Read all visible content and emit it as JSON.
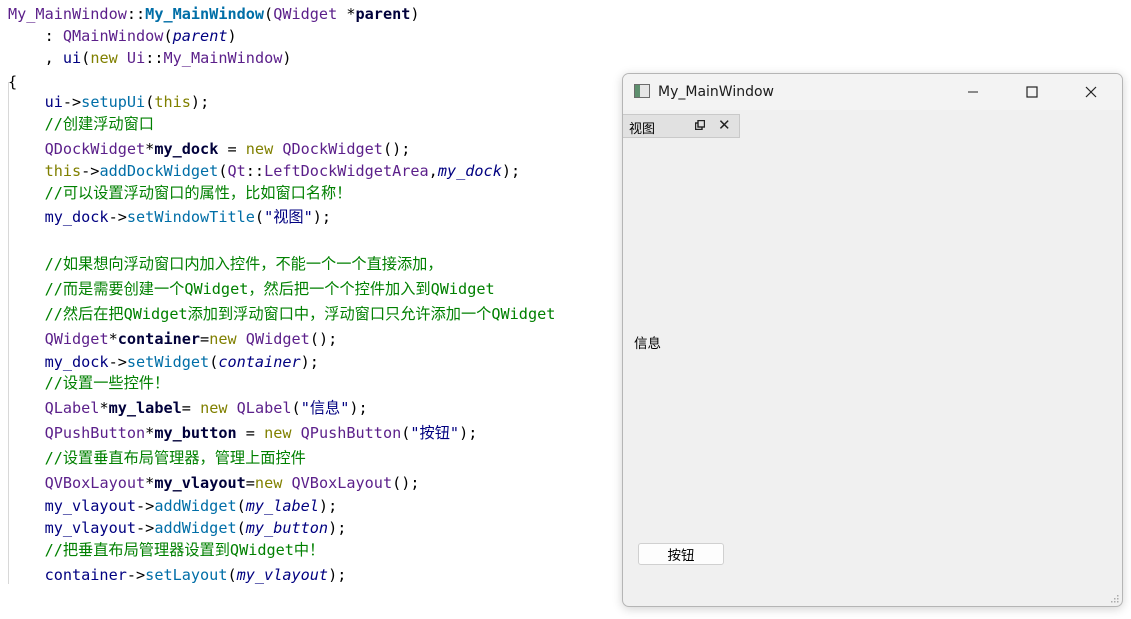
{
  "colors": {
    "default": "#000080",
    "type": "#5b1f8a",
    "var": "#00003a",
    "func": "#006ea7",
    "keyword": "#808000",
    "comment": "#008000",
    "string": "#000080",
    "param": "#000080",
    "plain": "#000000"
  },
  "code": [
    {
      "tokens": [
        {
          "t": "My_MainWindow",
          "c": "type"
        },
        {
          "t": "::",
          "c": "plain"
        },
        {
          "t": "My_MainWindow",
          "c": "func",
          "b": true
        },
        {
          "t": "(",
          "c": "plain"
        },
        {
          "t": "QWidget",
          "c": "type"
        },
        {
          "t": " *",
          "c": "plain"
        },
        {
          "t": "parent",
          "c": "var",
          "b": true
        },
        {
          "t": ")",
          "c": "plain"
        }
      ]
    },
    {
      "tokens": [
        {
          "t": "    : ",
          "c": "plain"
        },
        {
          "t": "QMainWindow",
          "c": "type"
        },
        {
          "t": "(",
          "c": "plain"
        },
        {
          "t": "parent",
          "c": "param",
          "i": true
        },
        {
          "t": ")",
          "c": "plain"
        }
      ]
    },
    {
      "tokens": [
        {
          "t": "    , ",
          "c": "plain"
        },
        {
          "t": "ui",
          "c": "default"
        },
        {
          "t": "(",
          "c": "plain"
        },
        {
          "t": "new",
          "c": "keyword"
        },
        {
          "t": " ",
          "c": "plain"
        },
        {
          "t": "Ui",
          "c": "type"
        },
        {
          "t": "::",
          "c": "plain"
        },
        {
          "t": "My_MainWindow",
          "c": "type"
        },
        {
          "t": ")",
          "c": "plain"
        }
      ]
    },
    {
      "tokens": [
        {
          "t": "{",
          "c": "plain"
        }
      ]
    },
    {
      "tokens": [
        {
          "t": "    ui",
          "c": "default"
        },
        {
          "t": "->",
          "c": "plain"
        },
        {
          "t": "setupUi",
          "c": "func"
        },
        {
          "t": "(",
          "c": "plain"
        },
        {
          "t": "this",
          "c": "keyword"
        },
        {
          "t": ");",
          "c": "plain"
        }
      ]
    },
    {
      "tokens": [
        {
          "t": "    //创建浮动窗口",
          "c": "comment"
        }
      ]
    },
    {
      "tokens": [
        {
          "t": "    ",
          "c": "plain"
        },
        {
          "t": "QDockWidget",
          "c": "type"
        },
        {
          "t": "*",
          "c": "plain"
        },
        {
          "t": "my_dock",
          "c": "var",
          "b": true
        },
        {
          "t": " = ",
          "c": "plain"
        },
        {
          "t": "new",
          "c": "keyword"
        },
        {
          "t": " ",
          "c": "plain"
        },
        {
          "t": "QDockWidget",
          "c": "type"
        },
        {
          "t": "();",
          "c": "plain"
        }
      ]
    },
    {
      "tokens": [
        {
          "t": "    ",
          "c": "plain"
        },
        {
          "t": "this",
          "c": "keyword"
        },
        {
          "t": "->",
          "c": "plain"
        },
        {
          "t": "addDockWidget",
          "c": "func"
        },
        {
          "t": "(",
          "c": "plain"
        },
        {
          "t": "Qt",
          "c": "type"
        },
        {
          "t": "::",
          "c": "plain"
        },
        {
          "t": "LeftDockWidgetArea",
          "c": "type"
        },
        {
          "t": ",",
          "c": "plain"
        },
        {
          "t": "my_dock",
          "c": "param",
          "i": true
        },
        {
          "t": ");",
          "c": "plain"
        }
      ]
    },
    {
      "tokens": [
        {
          "t": "    //可以设置浮动窗口的属性，比如窗口名称！",
          "c": "comment"
        }
      ]
    },
    {
      "tokens": [
        {
          "t": "    my_dock",
          "c": "default"
        },
        {
          "t": "->",
          "c": "plain"
        },
        {
          "t": "setWindowTitle",
          "c": "func"
        },
        {
          "t": "(",
          "c": "plain"
        },
        {
          "t": "\"视图\"",
          "c": "string"
        },
        {
          "t": ");",
          "c": "plain"
        }
      ]
    },
    {
      "tokens": []
    },
    {
      "tokens": [
        {
          "t": "    //如果想向浮动窗口内加入控件，不能一个一个直接添加，",
          "c": "comment"
        }
      ]
    },
    {
      "tokens": [
        {
          "t": "    //而是需要创建一个QWidget，然后把一个个控件加入到QWidget",
          "c": "comment"
        }
      ]
    },
    {
      "tokens": [
        {
          "t": "    //然后在把QWidget添加到浮动窗口中，浮动窗口只允许添加一个QWidget",
          "c": "comment"
        }
      ]
    },
    {
      "tokens": [
        {
          "t": "    ",
          "c": "plain"
        },
        {
          "t": "QWidget",
          "c": "type"
        },
        {
          "t": "*",
          "c": "plain"
        },
        {
          "t": "container",
          "c": "var",
          "b": true
        },
        {
          "t": "=",
          "c": "plain"
        },
        {
          "t": "new",
          "c": "keyword"
        },
        {
          "t": " ",
          "c": "plain"
        },
        {
          "t": "QWidget",
          "c": "type"
        },
        {
          "t": "();",
          "c": "plain"
        }
      ]
    },
    {
      "tokens": [
        {
          "t": "    my_dock",
          "c": "default"
        },
        {
          "t": "->",
          "c": "plain"
        },
        {
          "t": "setWidget",
          "c": "func"
        },
        {
          "t": "(",
          "c": "plain"
        },
        {
          "t": "container",
          "c": "param",
          "i": true
        },
        {
          "t": ");",
          "c": "plain"
        }
      ]
    },
    {
      "tokens": [
        {
          "t": "    //设置一些控件！",
          "c": "comment"
        }
      ]
    },
    {
      "tokens": [
        {
          "t": "    ",
          "c": "plain"
        },
        {
          "t": "QLabel",
          "c": "type"
        },
        {
          "t": "*",
          "c": "plain"
        },
        {
          "t": "my_label",
          "c": "var",
          "b": true
        },
        {
          "t": "= ",
          "c": "plain"
        },
        {
          "t": "new",
          "c": "keyword"
        },
        {
          "t": " ",
          "c": "plain"
        },
        {
          "t": "QLabel",
          "c": "type"
        },
        {
          "t": "(",
          "c": "plain"
        },
        {
          "t": "\"信息\"",
          "c": "string"
        },
        {
          "t": ");",
          "c": "plain"
        }
      ]
    },
    {
      "tokens": [
        {
          "t": "    ",
          "c": "plain"
        },
        {
          "t": "QPushButton",
          "c": "type"
        },
        {
          "t": "*",
          "c": "plain"
        },
        {
          "t": "my_button",
          "c": "var",
          "b": true
        },
        {
          "t": " = ",
          "c": "plain"
        },
        {
          "t": "new",
          "c": "keyword"
        },
        {
          "t": " ",
          "c": "plain"
        },
        {
          "t": "QPushButton",
          "c": "type"
        },
        {
          "t": "(",
          "c": "plain"
        },
        {
          "t": "\"按钮\"",
          "c": "string"
        },
        {
          "t": ");",
          "c": "plain"
        }
      ]
    },
    {
      "tokens": [
        {
          "t": "    //设置垂直布局管理器，管理上面控件",
          "c": "comment"
        }
      ]
    },
    {
      "tokens": [
        {
          "t": "    ",
          "c": "plain"
        },
        {
          "t": "QVBoxLayout",
          "c": "type"
        },
        {
          "t": "*",
          "c": "plain"
        },
        {
          "t": "my_vlayout",
          "c": "var",
          "b": true
        },
        {
          "t": "=",
          "c": "plain"
        },
        {
          "t": "new",
          "c": "keyword"
        },
        {
          "t": " ",
          "c": "plain"
        },
        {
          "t": "QVBoxLayout",
          "c": "type"
        },
        {
          "t": "();",
          "c": "plain"
        }
      ]
    },
    {
      "tokens": [
        {
          "t": "    my_vlayout",
          "c": "default"
        },
        {
          "t": "->",
          "c": "plain"
        },
        {
          "t": "addWidget",
          "c": "func"
        },
        {
          "t": "(",
          "c": "plain"
        },
        {
          "t": "my_label",
          "c": "param",
          "i": true
        },
        {
          "t": ");",
          "c": "plain"
        }
      ]
    },
    {
      "tokens": [
        {
          "t": "    my_vlayout",
          "c": "default"
        },
        {
          "t": "->",
          "c": "plain"
        },
        {
          "t": "addWidget",
          "c": "func"
        },
        {
          "t": "(",
          "c": "plain"
        },
        {
          "t": "my_button",
          "c": "param",
          "i": true
        },
        {
          "t": ");",
          "c": "plain"
        }
      ]
    },
    {
      "tokens": [
        {
          "t": "    //把垂直布局管理器设置到QWidget中！",
          "c": "comment"
        }
      ]
    },
    {
      "tokens": [
        {
          "t": "    container",
          "c": "default"
        },
        {
          "t": "->",
          "c": "plain"
        },
        {
          "t": "setLayout",
          "c": "func"
        },
        {
          "t": "(",
          "c": "plain"
        },
        {
          "t": "my_vlayout",
          "c": "param",
          "i": true
        },
        {
          "t": ");",
          "c": "plain"
        }
      ]
    }
  ],
  "window": {
    "title": "My_MainWindow",
    "icons": {
      "app": "app-window-icon",
      "minimize": "minimize-icon",
      "maximize": "maximize-icon",
      "close": "close-icon"
    },
    "dock": {
      "title": "视图",
      "float_icon": "dock-float-icon",
      "close_icon": "dock-close-icon"
    },
    "label_text": "信息",
    "button_text": "按钮"
  }
}
